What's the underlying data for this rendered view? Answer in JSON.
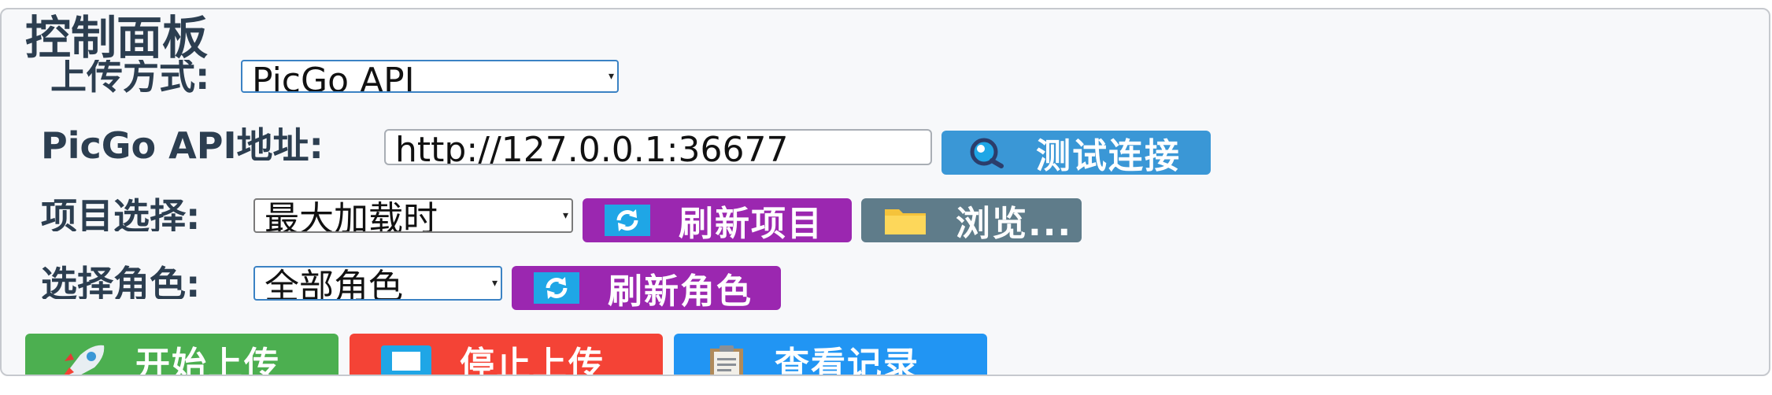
{
  "panel": {
    "title": "控制面板"
  },
  "upload_method": {
    "label": "上传方式:",
    "value": "PicGo API"
  },
  "api_address": {
    "label": "PicGo API地址:",
    "value": "http://127.0.0.1:36677",
    "test_button": "测试连接",
    "test_icon": "magnifier-icon"
  },
  "project": {
    "label": "项目选择:",
    "value": "最大加载时",
    "refresh_button": "刷新项目",
    "refresh_icon": "refresh-icon",
    "browse_button": "浏览...",
    "browse_icon": "folder-icon"
  },
  "role": {
    "label": "选择角色:",
    "value": "全部角色",
    "refresh_button": "刷新角色",
    "refresh_icon": "refresh-icon"
  },
  "actions": {
    "start": "开始上传",
    "start_icon": "rocket-icon",
    "stop": "停止上传",
    "stop_icon": "stop-icon",
    "history": "查看记录",
    "history_icon": "clipboard-icon"
  },
  "colors": {
    "blue": "#3a97d6",
    "purple": "#9b27b0",
    "slate": "#5f7c8a",
    "green": "#4caf50",
    "red": "#f44336",
    "sky": "#2195f3"
  }
}
